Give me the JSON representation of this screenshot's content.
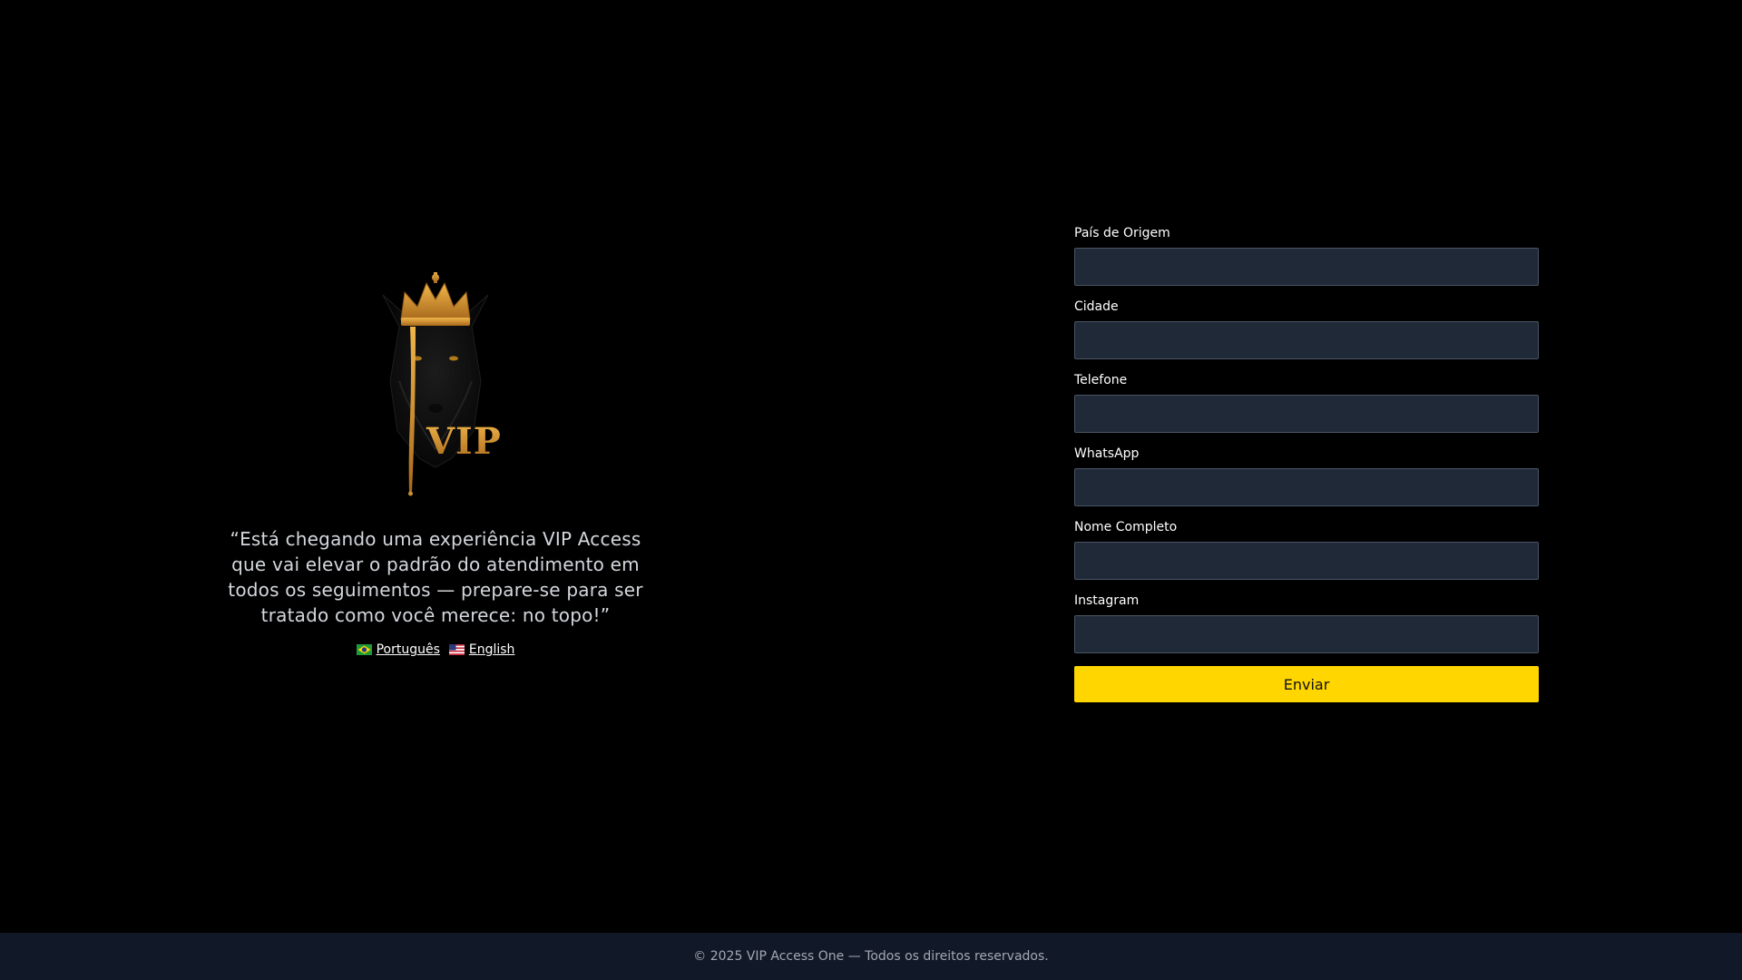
{
  "brand": {
    "logo_icon": "crowned-wolf-vip-logo-icon",
    "logo_text": "VIP",
    "tagline": "“Está chegando uma experiência VIP Access que vai elevar o padrão do atendimento em todos os seguimentos — prepare-se para ser tratado como você merece: no topo!”",
    "languages": [
      {
        "label": "Português",
        "flag_icon": "brazil-flag-icon"
      },
      {
        "label": "English",
        "flag_icon": "usa-flag-icon"
      }
    ]
  },
  "form": {
    "fields": [
      {
        "label": "País de Origem",
        "value": "",
        "placeholder": ""
      },
      {
        "label": "Cidade",
        "value": "",
        "placeholder": ""
      },
      {
        "label": "Telefone",
        "value": "",
        "placeholder": ""
      },
      {
        "label": "WhatsApp",
        "value": "",
        "placeholder": ""
      },
      {
        "label": "Nome Completo",
        "value": "",
        "placeholder": ""
      },
      {
        "label": "Instagram",
        "value": "",
        "placeholder": ""
      }
    ],
    "submit_label": "Enviar"
  },
  "footer": {
    "text": "© 2025 VIP Access One — Todos os direitos reservados."
  },
  "colors": {
    "background": "#000000",
    "accent": "#ffd600",
    "input_bg": "#1f2937",
    "gold": "#c8922a",
    "footer_bg": "#111827"
  }
}
